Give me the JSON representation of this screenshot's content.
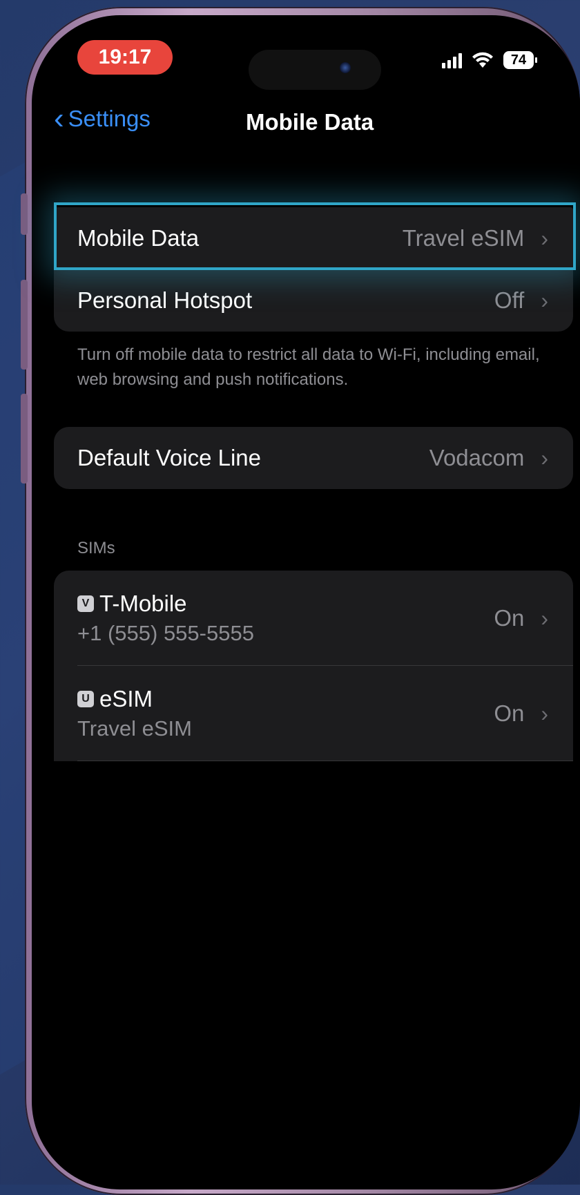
{
  "status_bar": {
    "time": "19:17",
    "battery": "74"
  },
  "nav": {
    "back_label": "Settings",
    "title": "Mobile Data"
  },
  "data_group": {
    "rows": [
      {
        "label": "Mobile Data",
        "value": "Travel eSIM"
      },
      {
        "label": "Personal Hotspot",
        "value": "Off"
      }
    ]
  },
  "footnote": "Turn off mobile data to restrict all data to Wi-Fi, including email, web browsing and push notifications.",
  "voice_group": {
    "label": "Default Voice Line",
    "value": "Vodacom"
  },
  "sims": {
    "header": "SIMs",
    "items": [
      {
        "badge": "V",
        "name": "T-Mobile",
        "sub": "+1 (555) 555-5555",
        "status": "On"
      },
      {
        "badge": "U",
        "name": "eSIM",
        "sub": "Travel eSIM",
        "status": "On"
      }
    ]
  },
  "colors": {
    "accent": "#3a8ff7",
    "highlight": "#30a6c8",
    "time_pill": "#e8453c"
  }
}
